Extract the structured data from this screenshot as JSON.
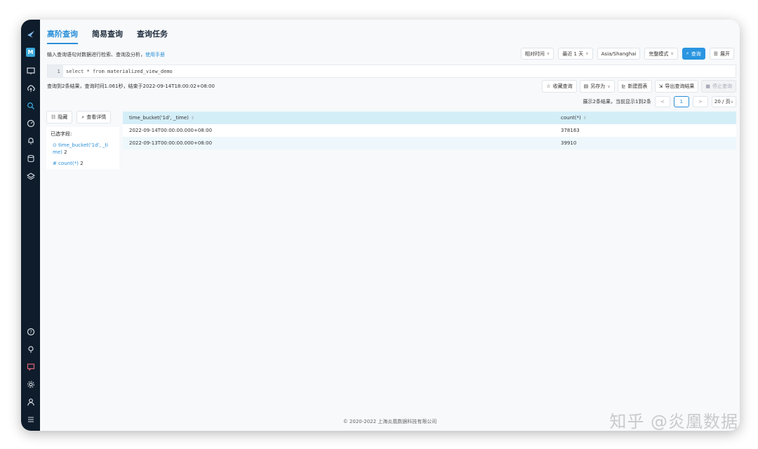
{
  "tabs": [
    {
      "label": "高阶查询",
      "active": true
    },
    {
      "label": "简易查询",
      "active": false
    },
    {
      "label": "查询任务",
      "active": false
    }
  ],
  "hint": {
    "text": "输入查询语句对数据进行检索、查询及分析，",
    "link": "使用手册"
  },
  "toolbar": {
    "time_mode": "相对时间",
    "time_range": "最近 1 天",
    "timezone": "Asia/Shanghai",
    "display_mode": "完整模式",
    "query_button": "查询",
    "expand_button": "展开"
  },
  "editor": {
    "line_number": "1",
    "kw_select": "select",
    "star": "*",
    "kw_from": "from",
    "table": "materialized_view_demo"
  },
  "status_text": "查询到2条结果，查询时间1.061秒，结束于2022-09-14T18:00:02+08:00",
  "actions": {
    "favorite": "收藏查询",
    "save_as": "另存为",
    "new_chart": "新建图表",
    "export": "导出查询结果",
    "stop": "停止查询"
  },
  "pagination": {
    "summary": "展示2条结果，当前显示1到2条",
    "prev": "<",
    "current_page": "1",
    "next": ">",
    "page_size": "20 / 页"
  },
  "field_panel": {
    "hide_button": "隐藏",
    "detail_button": "查看详情",
    "title": "已选字段:",
    "fields": [
      {
        "icon": "⊙",
        "name": "time_bucket('1d', _ti me)",
        "count": "2"
      },
      {
        "icon": "#",
        "name": "count(*)",
        "count": "2"
      }
    ]
  },
  "table": {
    "columns": [
      "time_bucket('1d', _time)",
      "count(*)"
    ],
    "rows": [
      [
        "2022-09-14T00:00:00.000+08:00",
        "378163"
      ],
      [
        "2022-09-13T00:00:00.000+08:00",
        "39910"
      ]
    ]
  },
  "footer": "© 2020-2022 上海炎凰数据科技有限公司",
  "watermark": "知乎 @炎凰数据",
  "sidebar": {
    "workspace_badge": "M"
  },
  "colors": {
    "accent": "#2a8fd8",
    "sidebar": "#0e1c2b",
    "table_header": "#d4eef8"
  }
}
